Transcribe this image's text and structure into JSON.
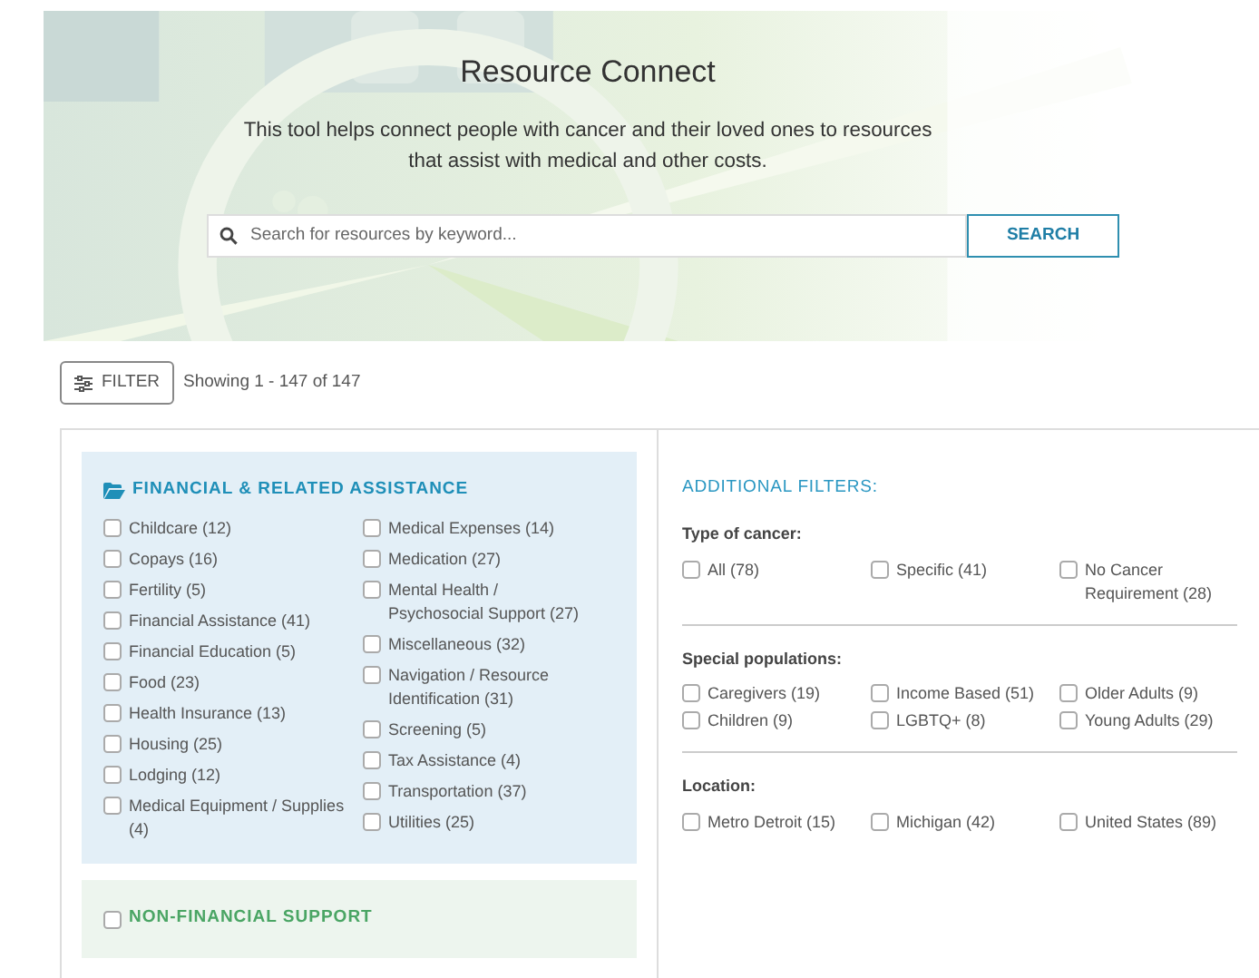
{
  "header": {
    "title": "Resource Connect",
    "description": "This tool helps connect people with cancer and their loved ones to resources that assist with medical and other costs.",
    "search": {
      "placeholder": "Search for resources by keyword...",
      "button": "SEARCH"
    }
  },
  "toolbar": {
    "filter_button": "FILTER",
    "results": "Showing 1 - 147 of 147"
  },
  "categories": [
    {
      "title": "FINANCIAL & RELATED ASSISTANCE",
      "kind": "expanded",
      "columns": [
        [
          {
            "label": "Childcare (12)",
            "checked": false
          },
          {
            "label": "Copays (16)",
            "checked": false
          },
          {
            "label": "Fertility (5)",
            "checked": false
          },
          {
            "label": "Financial Assistance (41)",
            "checked": false
          },
          {
            "label": "Financial Education (5)",
            "checked": false
          },
          {
            "label": "Food (23)",
            "checked": false
          },
          {
            "label": "Health Insurance (13)",
            "checked": false
          },
          {
            "label": "Housing (25)",
            "checked": false
          },
          {
            "label": "Lodging (12)",
            "checked": false
          },
          {
            "label": "Medical Equipment / Supplies (4)",
            "checked": false
          }
        ],
        [
          {
            "label": "Medical Expenses (14)",
            "checked": false
          },
          {
            "label": "Medication (27)",
            "checked": false
          },
          {
            "label": "Mental Health / Psychosocial Support (27)",
            "checked": false
          },
          {
            "label": "Miscellaneous (32)",
            "checked": false
          },
          {
            "label": "Navigation / Resource Identification (31)",
            "checked": false
          },
          {
            "label": "Screening (5)",
            "checked": false
          },
          {
            "label": "Tax Assistance (4)",
            "checked": false
          },
          {
            "label": "Transportation (37)",
            "checked": false
          },
          {
            "label": "Utilities (25)",
            "checked": false
          }
        ]
      ]
    },
    {
      "title": "NON-FINANCIAL SUPPORT",
      "kind": "collapsed",
      "checked": false
    }
  ],
  "additional_filters": {
    "title": "ADDITIONAL FILTERS:",
    "groups": [
      {
        "label": "Type of cancer:",
        "options": [
          {
            "label": "All (78)",
            "checked": false
          },
          {
            "label": "Specific (41)",
            "checked": false
          },
          {
            "label": "No Cancer Requirement (28)",
            "checked": false
          }
        ]
      },
      {
        "label": "Special populations:",
        "options": [
          {
            "label": "Caregivers (19)",
            "checked": false
          },
          {
            "label": "Income Based (51)",
            "checked": false
          },
          {
            "label": "Older Adults (9)",
            "checked": false
          },
          {
            "label": "Children (9)",
            "checked": false
          },
          {
            "label": "LGBTQ+ (8)",
            "checked": false
          },
          {
            "label": "Young Adults (29)",
            "checked": false
          }
        ]
      },
      {
        "label": "Location:",
        "options": [
          {
            "label": "Metro Detroit (15)",
            "checked": false
          },
          {
            "label": "Michigan (42)",
            "checked": false
          },
          {
            "label": "United States (89)",
            "checked": false
          }
        ]
      }
    ]
  }
}
